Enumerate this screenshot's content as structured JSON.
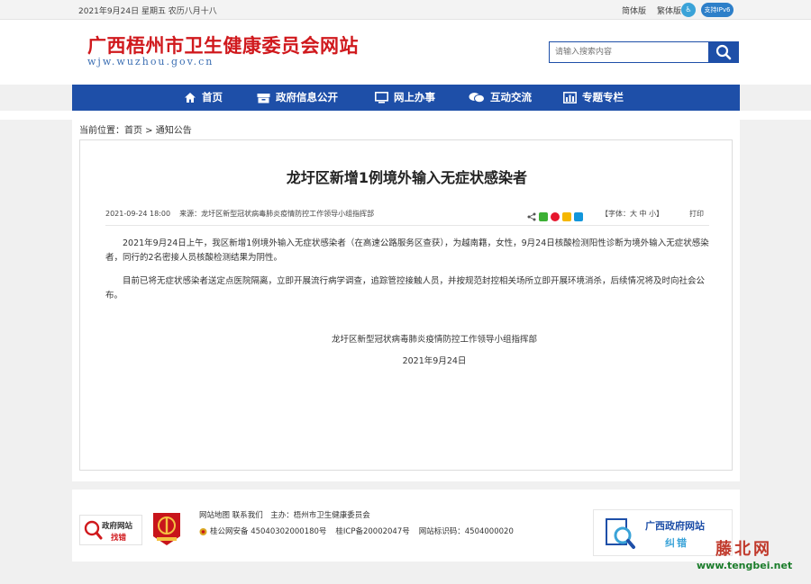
{
  "topbar": {
    "date": "2021年9月24日 星期五 农历八月十八",
    "simplified": "简体版",
    "traditional": "繁体版",
    "ipv6": "支持IPv6"
  },
  "header": {
    "title": "广西梧州市卫生健康委员会网站",
    "domain": "wjw.wuzhou.gov.cn",
    "search_placeholder": "请输入搜索内容"
  },
  "nav": {
    "items": [
      {
        "label": "首页",
        "icon": "home-icon"
      },
      {
        "label": "政府信息公开",
        "icon": "archive-icon"
      },
      {
        "label": "网上办事",
        "icon": "monitor-icon"
      },
      {
        "label": "互动交流",
        "icon": "chat-icon"
      },
      {
        "label": "专题专栏",
        "icon": "chart-icon"
      }
    ]
  },
  "breadcrumb": "当前位置：首页 > 通知公告",
  "article": {
    "title": "龙圩区新增1例境外输入无症状感染者",
    "date": "2021-09-24 18:00",
    "source": "来源：龙圩区新型冠状病毒肺炎疫情防控工作领导小组指挥部",
    "font_size": "【字体：大 中 小】",
    "print": "打印",
    "paragraphs": [
      "2021年9月24日上午，我区新增1例境外输入无症状感染者（在高速公路服务区查获），为越南籍，女性，9月24日核酸检测阳性诊断为境外输入无症状感染者，同行的2名密接人员核酸检测结果为阴性。",
      "目前已将无症状感染者送定点医院隔离，立即开展流行病学调查，追踪管控接触人员，并按规范封控相关场所立即开展环境消杀，后续情况将及时向社会公布。"
    ],
    "signature_org": "龙圩区新型冠状病毒肺炎疫情防控工作领导小组指挥部",
    "signature_date": "2021年9月24日"
  },
  "footer": {
    "links": "网站地图 联系我们　主办：梧州市卫生健康委员会",
    "police": "桂公网安备 45040302000180号",
    "icp": "桂ICP备20002047号",
    "site_code": "网站标识码：4504000020",
    "logo1_line1": "政府网站",
    "logo1_line2": "找错",
    "gx_title": "广西政府网站",
    "gx_sub": "纠错"
  },
  "watermark": {
    "cn": "藤北网",
    "url": "www.tengbei.net"
  },
  "colors": {
    "brand_blue": "#1e4fa8",
    "title_red": "#d0191d"
  }
}
